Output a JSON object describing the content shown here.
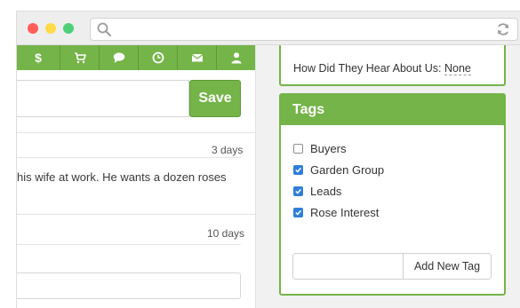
{
  "window": {
    "controls": [
      "close-dot",
      "minimize-dot",
      "maximize-dot"
    ],
    "address_bar": {
      "value": "",
      "search_icon": "search-icon",
      "reload_icon": "reload-icon"
    }
  },
  "toolbar": {
    "accent_color": "#74b448",
    "buttons": [
      {
        "name": "dollar",
        "icon": "dollar-icon",
        "glyph": "$"
      },
      {
        "name": "cart",
        "icon": "cart-icon"
      },
      {
        "name": "chat",
        "icon": "chat-bubble-icon"
      },
      {
        "name": "clock",
        "icon": "clock-icon"
      },
      {
        "name": "mail",
        "icon": "envelope-icon"
      },
      {
        "name": "user",
        "icon": "user-icon"
      }
    ]
  },
  "note_form": {
    "input_value": "",
    "save_label": "Save"
  },
  "feed": [
    {
      "time": "3 days",
      "text": "his wife at work. He wants a dozen roses"
    },
    {
      "time": "10 days",
      "text": ""
    }
  ],
  "contact": {
    "how_label": "How Did They Hear About Us:",
    "how_value": "None"
  },
  "tags": {
    "title": "Tags",
    "items": [
      {
        "label": "Buyers",
        "checked": false
      },
      {
        "label": "Garden Group",
        "checked": true
      },
      {
        "label": "Leads",
        "checked": true
      },
      {
        "label": "Rose Interest",
        "checked": true
      }
    ],
    "new_tag_value": "",
    "add_label": "Add New Tag",
    "checkbox_color": "#2f7fd8"
  }
}
